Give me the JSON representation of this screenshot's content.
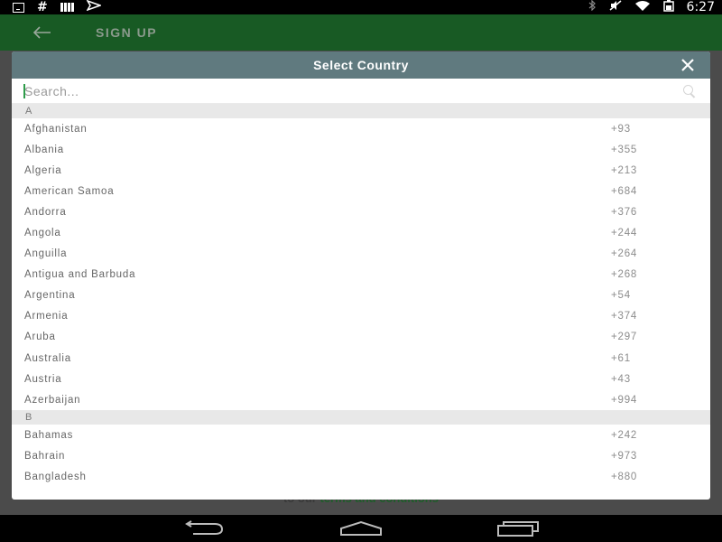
{
  "status_bar": {
    "time": "6:27",
    "left_icons": [
      "download-icon",
      "hash-icon",
      "bars-icon",
      "send-icon"
    ],
    "right_icons": [
      "bluetooth-icon",
      "mute-icon",
      "wifi-icon",
      "battery-icon"
    ]
  },
  "app_bar": {
    "title": "SIGN UP",
    "back_icon": "arrow-left-icon"
  },
  "background": {
    "link_prefix": "to our",
    "link_text": "terms and conditions"
  },
  "dialog": {
    "title": "Select Country",
    "close_label": "✕",
    "search": {
      "placeholder": "Search...",
      "value": ""
    },
    "sections": [
      {
        "letter": "A",
        "countries": [
          {
            "name": "Afghanistan",
            "code": "+93"
          },
          {
            "name": "Albania",
            "code": "+355"
          },
          {
            "name": "Algeria",
            "code": "+213"
          },
          {
            "name": "American Samoa",
            "code": "+684"
          },
          {
            "name": "Andorra",
            "code": "+376"
          },
          {
            "name": "Angola",
            "code": "+244"
          },
          {
            "name": "Anguilla",
            "code": "+264"
          },
          {
            "name": "Antigua and Barbuda",
            "code": "+268"
          },
          {
            "name": "Argentina",
            "code": "+54"
          },
          {
            "name": "Armenia",
            "code": "+374"
          },
          {
            "name": "Aruba",
            "code": "+297"
          },
          {
            "name": "Australia",
            "code": "+61"
          },
          {
            "name": "Austria",
            "code": "+43"
          },
          {
            "name": "Azerbaijan",
            "code": "+994"
          }
        ]
      },
      {
        "letter": "B",
        "countries": [
          {
            "name": "Bahamas",
            "code": "+242"
          },
          {
            "name": "Bahrain",
            "code": "+973"
          },
          {
            "name": "Bangladesh",
            "code": "+880"
          }
        ]
      }
    ]
  },
  "nav_bar": {
    "buttons": [
      "back-icon",
      "home-icon",
      "recents-icon"
    ]
  },
  "colors": {
    "app_bar": "#185a24",
    "dialog_header": "#607a7f",
    "section_header_bg": "#e8e8e8",
    "cursor": "#2e9c4a"
  }
}
